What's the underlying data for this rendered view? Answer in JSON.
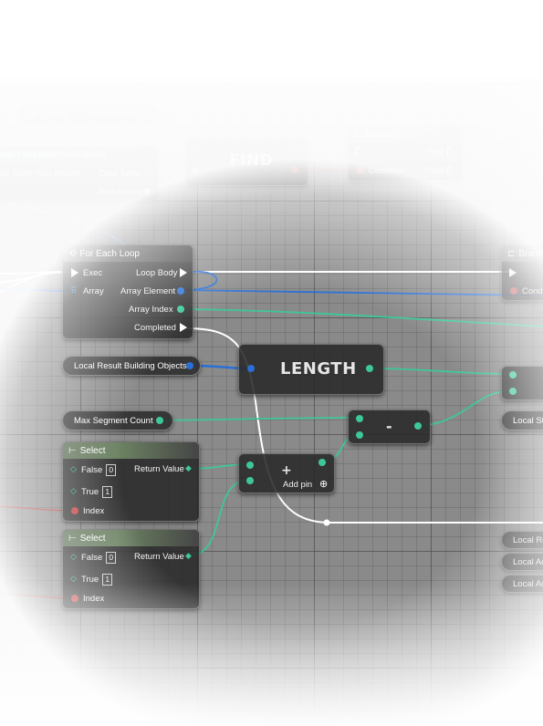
{
  "nodes": {
    "target": {
      "target_label": "Target",
      "owned_items_label": "Owned Items"
    },
    "break_row": {
      "title": "reak DataTableRowHandle",
      "in_label": "ata Table Row Handle",
      "data_table_label": "Data Table",
      "row_name_label": "Row Name"
    },
    "find": {
      "title": "FIND"
    },
    "branch1": {
      "title": "Branch",
      "true_label": "True",
      "false_label": "False",
      "condition_label": "Condition"
    },
    "for_each": {
      "title": "For Each Loop",
      "exec_label": "Exec",
      "array_label": "Array",
      "loop_body_label": "Loop Body",
      "array_element_label": "Array Element",
      "array_index_label": "Array Index",
      "completed_label": "Completed"
    },
    "branch2": {
      "title": "Branch",
      "condition_label": "Conditi"
    },
    "local_result": {
      "label": "Local Result Building Objects"
    },
    "length": {
      "title": "LENGTH"
    },
    "max_segment": {
      "label": "Max Segment Count"
    },
    "minus": {
      "title": "-"
    },
    "local_st": {
      "label": "Local St"
    },
    "select1": {
      "title": "Select",
      "false_label": "False",
      "false_value": "0",
      "true_label": "True",
      "true_value": "1",
      "index_label": "Index",
      "return_label": "Return Value"
    },
    "add": {
      "symbol": "+",
      "add_pin_label": "Add pin"
    },
    "select2": {
      "title": "Select",
      "false_label": "False",
      "false_value": "0",
      "true_label": "True",
      "true_value": "1",
      "index_label": "Index",
      "return_label": "Return Value"
    },
    "right_vars": [
      "Local Re",
      "Local Ac",
      "Local Ac"
    ]
  },
  "colors": {
    "background": "#8a8a8a",
    "exec_wire": "#ffffff",
    "int_wire": "#3ec79a",
    "object_wire": "#2a6fd6",
    "bool_wire": "#c23c3c",
    "name_pin": "#d38fe6",
    "struct_wire": "#3a8fd8"
  },
  "icons": [
    "loop-icon",
    "branch-icon",
    "select-icon",
    "array-icon",
    "add-pin-icon"
  ]
}
